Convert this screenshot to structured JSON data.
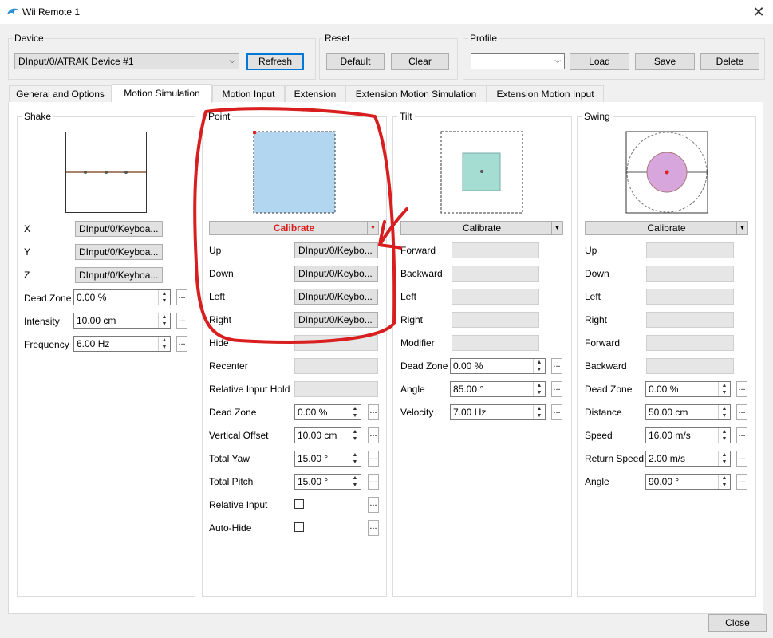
{
  "window": {
    "title": "Wii Remote 1",
    "close_glyph": "✕"
  },
  "device": {
    "label": "Device",
    "selected": "DInput/0/ATRAK Device #1",
    "refresh": "Refresh"
  },
  "reset": {
    "label": "Reset",
    "default": "Default",
    "clear": "Clear"
  },
  "profile": {
    "label": "Profile",
    "selected": "",
    "load": "Load",
    "save": "Save",
    "delete": "Delete"
  },
  "tabs": [
    "General and Options",
    "Motion Simulation",
    "Motion Input",
    "Extension",
    "Extension Motion Simulation",
    "Extension Motion Input"
  ],
  "active_tab": "Motion Simulation",
  "shake": {
    "title": "Shake",
    "rows": [
      {
        "label": "X",
        "value": "DInput/0/Keyboa..."
      },
      {
        "label": "Y",
        "value": "DInput/0/Keyboa..."
      },
      {
        "label": "Z",
        "value": "DInput/0/Keyboa..."
      }
    ],
    "settings": [
      {
        "label": "Dead Zone",
        "value": "0.00 %"
      },
      {
        "label": "Intensity",
        "value": "10.00 cm"
      },
      {
        "label": "Frequency",
        "value": "6.00 Hz"
      }
    ]
  },
  "point": {
    "title": "Point",
    "calibrate": "Calibrate",
    "bindings": [
      {
        "label": "Up",
        "value": "DInput/0/Keybo..."
      },
      {
        "label": "Down",
        "value": "DInput/0/Keybo..."
      },
      {
        "label": "Left",
        "value": "DInput/0/Keybo..."
      },
      {
        "label": "Right",
        "value": "DInput/0/Keybo..."
      },
      {
        "label": "Hide",
        "value": ""
      },
      {
        "label": "Recenter",
        "value": ""
      },
      {
        "label": "Relative Input Hold",
        "value": ""
      }
    ],
    "settings": [
      {
        "label": "Dead Zone",
        "value": "0.00 %"
      },
      {
        "label": "Vertical Offset",
        "value": "10.00 cm"
      },
      {
        "label": "Total Yaw",
        "value": "15.00 °"
      },
      {
        "label": "Total Pitch",
        "value": "15.00 °"
      }
    ],
    "checks": [
      {
        "label": "Relative Input",
        "checked": false
      },
      {
        "label": "Auto-Hide",
        "checked": false
      }
    ]
  },
  "tilt": {
    "title": "Tilt",
    "calibrate": "Calibrate",
    "bindings": [
      "Forward",
      "Backward",
      "Left",
      "Right",
      "Modifier"
    ],
    "settings": [
      {
        "label": "Dead Zone",
        "value": "0.00 %"
      },
      {
        "label": "Angle",
        "value": "85.00 °"
      },
      {
        "label": "Velocity",
        "value": "7.00 Hz"
      }
    ]
  },
  "swing": {
    "title": "Swing",
    "calibrate": "Calibrate",
    "bindings": [
      "Up",
      "Down",
      "Left",
      "Right",
      "Forward",
      "Backward"
    ],
    "settings": [
      {
        "label": "Dead Zone",
        "value": "0.00 %"
      },
      {
        "label": "Distance",
        "value": "50.00 cm"
      },
      {
        "label": "Speed",
        "value": "16.00 m/s"
      },
      {
        "label": "Return Speed",
        "value": "2.00 m/s"
      },
      {
        "label": "Angle",
        "value": "90.00 °"
      }
    ]
  },
  "footer": {
    "close": "Close"
  },
  "colors": {
    "annotation_red": "#d81e1e",
    "point_fill": "#b3d6f0",
    "tilt_fill": "#a6ddd2",
    "swing_fill": "#d7a6dc",
    "shake_line": "#8b5a3c",
    "focus_blue": "#0078d7"
  },
  "icons": {
    "app": "dolphin-icon",
    "dropdown": "chevron-down-icon",
    "spin": "spin-arrows-icon"
  }
}
